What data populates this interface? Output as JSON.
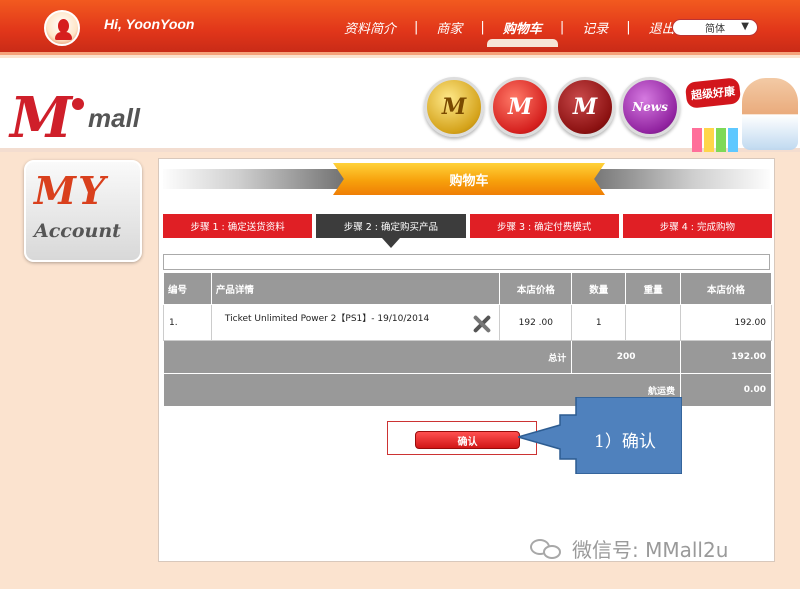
{
  "header": {
    "greeting": "Hi, YoonYoon",
    "nav": [
      "资料简介",
      "商家",
      "购物车",
      "记录",
      "退出"
    ],
    "active_nav": "购物车",
    "language": "简体"
  },
  "logo": {
    "m": "M",
    "mall": "mall"
  },
  "icons": {
    "c1": "M",
    "c2": "M",
    "c3": "M",
    "c4": "News"
  },
  "promo": {
    "badge": "超级好康"
  },
  "sidebar": {
    "my": "MY",
    "account": "Account"
  },
  "panel": {
    "title": "购物车",
    "steps": [
      "步骤 1 : 确定送货资料",
      "步骤 2 : 确定购买产品",
      "步骤 3 : 确定付费模式",
      "步骤 4 : 完成购物"
    ],
    "active_step": 1
  },
  "table": {
    "headers": [
      "编号",
      "产品详情",
      "本店价格",
      "数量",
      "重量",
      "本店价格"
    ],
    "rows": [
      {
        "no": "1.",
        "product": "Ticket Unlimited Power 2【PS1】- 19/10/2014",
        "price": "192 .00",
        "qty": "1",
        "weight": "",
        "total": "192.00"
      }
    ],
    "total_label": "总计",
    "total_qty": "200",
    "total_price": "192.00",
    "shipping_label": "航运费",
    "shipping_price": "0.00"
  },
  "confirm_label": "确认",
  "callout_text": "1）确认",
  "watermark": "微信号: MMall2u",
  "colors": {
    "topbar": "#e1361a",
    "step": "#e01f25",
    "step_active": "#3c3c3c",
    "callout": "#4f81bd"
  }
}
